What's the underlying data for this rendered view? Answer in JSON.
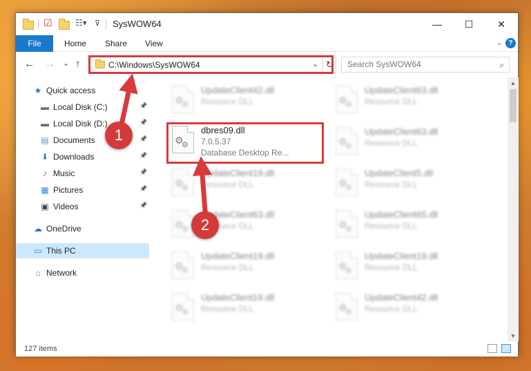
{
  "window": {
    "title": "SysWOW64",
    "controls": {
      "minimize": "—",
      "maximize": "☐",
      "close": "✕"
    }
  },
  "ribbon": {
    "file": "File",
    "home": "Home",
    "share": "Share",
    "view": "View",
    "help": "?"
  },
  "navigation": {
    "back": "←",
    "forward": "→",
    "recent": "⌄",
    "up": "↑",
    "address": "C:\\Windows\\SysWOW64",
    "search_placeholder": "Search SysWOW64"
  },
  "sidebar": {
    "items": [
      {
        "label": "Quick access",
        "icon": "star-icon",
        "pinned": false
      },
      {
        "label": "Local Disk (C:)",
        "icon": "drive-icon",
        "pinned": true
      },
      {
        "label": "Local Disk (D:)",
        "icon": "drive-icon",
        "pinned": true
      },
      {
        "label": "Documents",
        "icon": "documents-icon",
        "pinned": true
      },
      {
        "label": "Downloads",
        "icon": "downloads-icon",
        "pinned": true
      },
      {
        "label": "Music",
        "icon": "music-icon",
        "pinned": true
      },
      {
        "label": "Pictures",
        "icon": "pictures-icon",
        "pinned": true
      },
      {
        "label": "Videos",
        "icon": "videos-icon",
        "pinned": true
      },
      {
        "label": "OneDrive",
        "icon": "cloud-icon",
        "pinned": false
      },
      {
        "label": "This PC",
        "icon": "computer-icon",
        "pinned": false,
        "selected": true
      },
      {
        "label": "Network",
        "icon": "network-icon",
        "pinned": false
      }
    ]
  },
  "files": {
    "highlighted": {
      "name": "dbres09.dll",
      "version": "7.0.5.37",
      "description": "Database Desktop Re..."
    },
    "left_column": [
      {
        "name": "UpdateClient42.dll",
        "description": "Resource DLL"
      },
      {
        "name": "UpdateClient19.dll",
        "description": "Resource DLL"
      },
      {
        "name": "UpdateClient63.dll",
        "description": "Resource DLL"
      },
      {
        "name": "UpdateClient19.dll",
        "description": "Resource DLL"
      },
      {
        "name": "UpdateClient19.dll",
        "description": "Resource DLL"
      }
    ],
    "right_column": [
      {
        "name": "UpdateClient63.dll",
        "description": "Resource DLL"
      },
      {
        "name": "UpdateClient63.dll",
        "description": "Resource DLL"
      },
      {
        "name": "UpdateClient5.dll",
        "description": "Resource DLL"
      },
      {
        "name": "UpdateClient65.dll",
        "description": "Resource DLL"
      },
      {
        "name": "UpdateClient19.dll",
        "description": "Resource DLL"
      },
      {
        "name": "UpdateClient42.dll",
        "description": "Resource DLL"
      }
    ]
  },
  "status": {
    "item_count": "127 items"
  },
  "annotations": {
    "step1": "1",
    "step2": "2",
    "color": "#d83a3a"
  }
}
